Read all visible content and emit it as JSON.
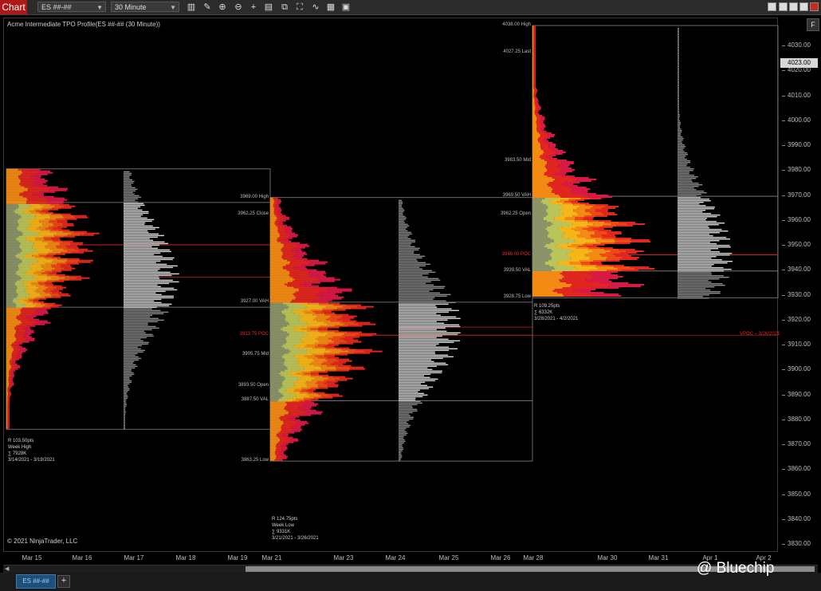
{
  "toolbar": {
    "chart_label": "Chart",
    "instrument": "ES ##-##",
    "interval": "30 Minute",
    "tools": [
      "bars-icon",
      "pencil-icon",
      "zoom-in-icon",
      "zoom-out-icon",
      "crosshair-icon",
      "properties-icon",
      "templates-icon",
      "screenshot-icon",
      "strategies-icon",
      "indicators-icon",
      "data-box-icon"
    ]
  },
  "chart_title": "Acme Intermediate TPO Profile(ES ##-## (30 Minute))",
  "f_button": "F",
  "current_price": "4023.00",
  "copyright": "© 2021 NinjaTrader, LLC",
  "watermark": "@ Bluechip",
  "tab_label": "ES ##-##",
  "add_tab": "+",
  "colors": {
    "background": "#000000",
    "poc_line": "#d42020",
    "value_area": "#8aa060",
    "accent_red": "#b01818"
  },
  "chart_data": {
    "type": "tpo-profile",
    "y_ticks": [
      4030,
      4020,
      4010,
      4000,
      3990,
      3980,
      3970,
      3960,
      3950,
      3940,
      3930,
      3920,
      3910,
      3900,
      3890,
      3880,
      3870,
      3860,
      3850,
      3840,
      3830
    ],
    "y_tick_labels": [
      "4030.00",
      "4020.00",
      "4010.00",
      "4000.00",
      "3990.00",
      "3980.00",
      "3970.00",
      "3960.00",
      "3950.00",
      "3940.00",
      "3930.00",
      "3920.00",
      "3910.00",
      "3900.00",
      "3890.00",
      "3880.00",
      "3870.00",
      "3860.00",
      "3850.00",
      "3840.00",
      "3830.00"
    ],
    "x_labels": [
      "Mar 15",
      "Mar 16",
      "Mar 17",
      "Mar 18",
      "Mar 19",
      "Mar 21",
      "Mar 23",
      "Mar 24",
      "Mar 25",
      "Mar 26",
      "Mar 28",
      "Mar 30",
      "Mar 31",
      "Apr 1",
      "Apr 2"
    ],
    "profiles": [
      {
        "name": "week1",
        "high": 3980.5,
        "low": 3876,
        "poc": 3950,
        "vah": 3967,
        "val": 3925,
        "volume_poc": 3937,
        "stats": [
          "R 103.50pts",
          "Week High",
          "∑ 7928K",
          "3/14/2021 - 3/19/2021"
        ],
        "labels": []
      },
      {
        "name": "week2",
        "high": 3969.0,
        "low": 3863.25,
        "poc": 3913.75,
        "vah": 3927.0,
        "val": 3887.5,
        "volume_poc": 3917,
        "stats": [
          "R 124.75pts",
          "Week Low",
          "∑ 9331K",
          "3/21/2021 - 3/26/2021"
        ],
        "labels": [
          {
            "text": "3969.00 High",
            "price": 3969.0,
            "poc": false
          },
          {
            "text": "3962.25 Close",
            "price": 3962.25,
            "poc": false
          },
          {
            "text": "3927.00 VAH",
            "price": 3927.0,
            "poc": false
          },
          {
            "text": "3913.75 POC",
            "price": 3913.75,
            "poc": true
          },
          {
            "text": "3905.75 Mid",
            "price": 3905.75,
            "poc": false
          },
          {
            "text": "3893.50 Open",
            "price": 3893.5,
            "poc": false
          },
          {
            "text": "3887.50 VAL",
            "price": 3887.5,
            "poc": false
          },
          {
            "text": "3863.25 Low",
            "price": 3863.25,
            "poc": false
          }
        ]
      },
      {
        "name": "week3",
        "high": 4038.0,
        "low": 3928.75,
        "poc": 3946.0,
        "vah": 3969.5,
        "val": 3939.5,
        "volume_poc": 3946,
        "stats": [
          "R 109.25pts",
          "∑ 6332K",
          "3/28/2021 - 4/2/2021"
        ],
        "labels": [
          {
            "text": "4038.00 High",
            "price": 4038.0,
            "poc": false
          },
          {
            "text": "4027.25 Last",
            "price": 4027.25,
            "poc": false
          },
          {
            "text": "3983.50 Mid",
            "price": 3983.5,
            "poc": false
          },
          {
            "text": "3969.50 VAH",
            "price": 3969.5,
            "poc": false
          },
          {
            "text": "3962.25 Open",
            "price": 3962.25,
            "poc": false
          },
          {
            "text": "3946.00 POC",
            "price": 3946.0,
            "poc": true
          },
          {
            "text": "3939.50 VAL",
            "price": 3939.5,
            "poc": false
          },
          {
            "text": "3928.75 Low",
            "price": 3928.75,
            "poc": false
          }
        ]
      }
    ],
    "vpoc_label": "VPOC – 3/26/2021"
  }
}
